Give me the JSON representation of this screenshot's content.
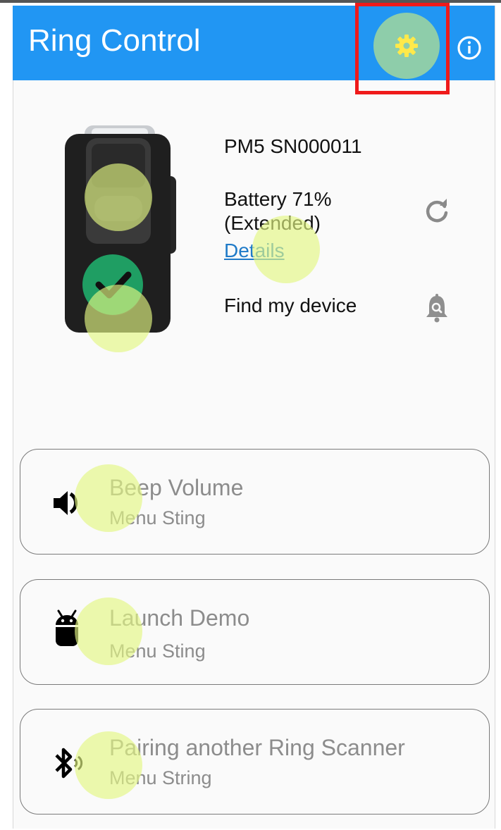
{
  "app": {
    "title": "Ring Control"
  },
  "colors": {
    "appbar": "#2196f3",
    "link": "#1f7ac8",
    "highlight": "#ef1a1a",
    "gear_button_bg": "#8ecdaa"
  },
  "header": {
    "settings_icon": "gear-icon",
    "info_icon": "info-icon"
  },
  "device": {
    "name": "PM5 SN000011",
    "battery_line1": "Battery 71%",
    "battery_line2": "(Extended)",
    "details_link": "Details",
    "find_label": "Find my device",
    "refresh_icon": "refresh-icon",
    "find_icon": "bell-search-icon",
    "status_icon": "checkmark-icon"
  },
  "menu": [
    {
      "title": "Beep Volume",
      "subtitle": "Menu Sting",
      "icon": "speaker-volume-icon"
    },
    {
      "title": "Launch Demo",
      "subtitle": "Menu Sting",
      "icon": "android-icon"
    },
    {
      "title": "Pairing another Ring Scanner",
      "subtitle": "Menu String",
      "icon": "bluetooth-icon"
    }
  ]
}
